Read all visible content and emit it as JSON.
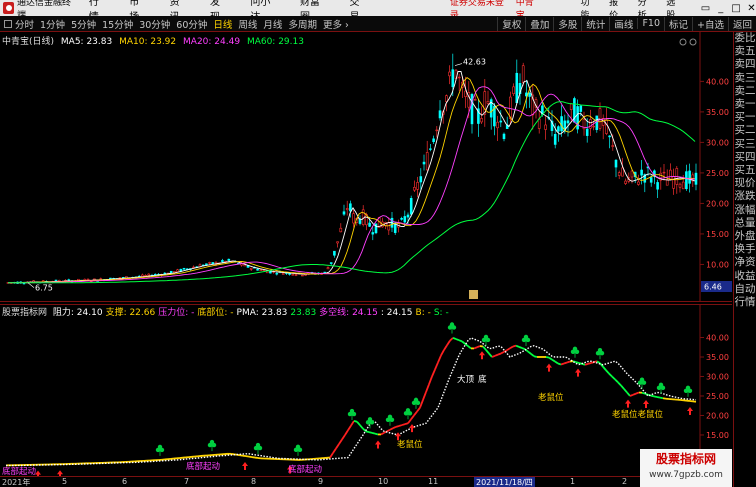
{
  "titlebar": {
    "app": "通达信金融终端",
    "menus": [
      "行情",
      "市场",
      "资讯",
      "发现",
      "问小达",
      "财富圈",
      "交易"
    ],
    "notice": "证券交易未登录",
    "stock": "中青宝",
    "buttons": [
      "功能",
      "报价",
      "分析",
      "选股"
    ],
    "win": [
      "▭",
      "_",
      "□",
      "✕"
    ]
  },
  "toolbar": {
    "periods": [
      "分时",
      "1分钟",
      "5分钟",
      "15分钟",
      "30分钟",
      "60分钟",
      "日线",
      "周线",
      "月线",
      "多周期",
      "更多 ›"
    ],
    "active_index": 6,
    "right_buttons": [
      "复权",
      "叠加",
      "多股",
      "统计",
      "画线",
      "F10",
      "标记",
      "+自选",
      "返回"
    ]
  },
  "main": {
    "title": "中青宝(日线)",
    "ma5": "MA5: 23.83",
    "ma10": "MA10: 23.92",
    "ma20": "MA20: 24.49",
    "ma60": "MA60: 29.13",
    "high_label": "42.63",
    "low_label": "6.75",
    "current_price": "6.46",
    "y_ticks": [
      "40.00",
      "35.00",
      "30.00",
      "25.00",
      "20.00",
      "15.00",
      "10.00"
    ],
    "y_vals": [
      40,
      35,
      30,
      25,
      20,
      15,
      10
    ],
    "ylim": [
      4.5,
      45.8
    ]
  },
  "indicator": {
    "title": "股票指标网",
    "items": [
      {
        "t": "阻力: 24.10",
        "c": "#ffffff"
      },
      {
        "t": "支撑: 22.66",
        "c": "#ffd400"
      },
      {
        "t": "压力位: -",
        "c": "#ff40ff"
      },
      {
        "t": "底部位: -",
        "c": "#ffd400"
      },
      {
        "t": "PMA: 23.83",
        "c": "#ffffff"
      },
      {
        "t": "23.83",
        "c": "#00ff40"
      },
      {
        "t": "多空线: 24.15",
        "c": "#ff40ff"
      },
      {
        "t": ": 24.15",
        "c": "#ffffff"
      },
      {
        "t": "B: -",
        "c": "#ffd400"
      },
      {
        "t": "S: -",
        "c": "#00ff40"
      }
    ],
    "y_ticks": [
      "40.00",
      "35.00",
      "30.00",
      "25.00",
      "20.00",
      "15.00",
      "10.00"
    ],
    "y_vals": [
      40,
      35,
      30,
      25,
      20,
      15,
      10
    ],
    "ylim": [
      5.5,
      45
    ],
    "annotations": [
      {
        "text": "大顶",
        "c": "#ffffff"
      },
      {
        "text": "底",
        "c": "#ffffff"
      },
      {
        "text": "老鼠位",
        "c": "#ffd400"
      },
      {
        "text": "老鼠位",
        "c": "#ffd400"
      },
      {
        "text": "老鼠位老鼠位",
        "c": "#ffd400"
      },
      {
        "text": "底部起动",
        "c": "#ff40ff"
      },
      {
        "text": "底部起动",
        "c": "#ff40ff"
      },
      {
        "text": "底部起动",
        "c": "#ff40ff"
      }
    ]
  },
  "right_panel": [
    "委比",
    "卖五",
    "卖四",
    "卖三",
    "卖二",
    "卖一",
    "买一",
    "买二",
    "买三",
    "买四",
    "买五",
    "现价",
    "涨跌",
    "涨幅",
    "总量",
    "外盘",
    "换手",
    "净资",
    "收益",
    "自动",
    "行情"
  ],
  "date_axis": [
    "2021年",
    "5",
    "6",
    "7",
    "8",
    "9",
    "10",
    "11",
    "2021/11/18/四",
    "1",
    "2"
  ],
  "watermark": {
    "line1": "股票指标网",
    "line2": "www.7gpzb.com"
  },
  "colors": {
    "up": "#ff3030",
    "down": "#00ffff",
    "ma5": "#ffffff",
    "ma10": "#ffd400",
    "ma20": "#ff40ff",
    "ma60": "#00ff40",
    "border": "#7a1010"
  }
}
